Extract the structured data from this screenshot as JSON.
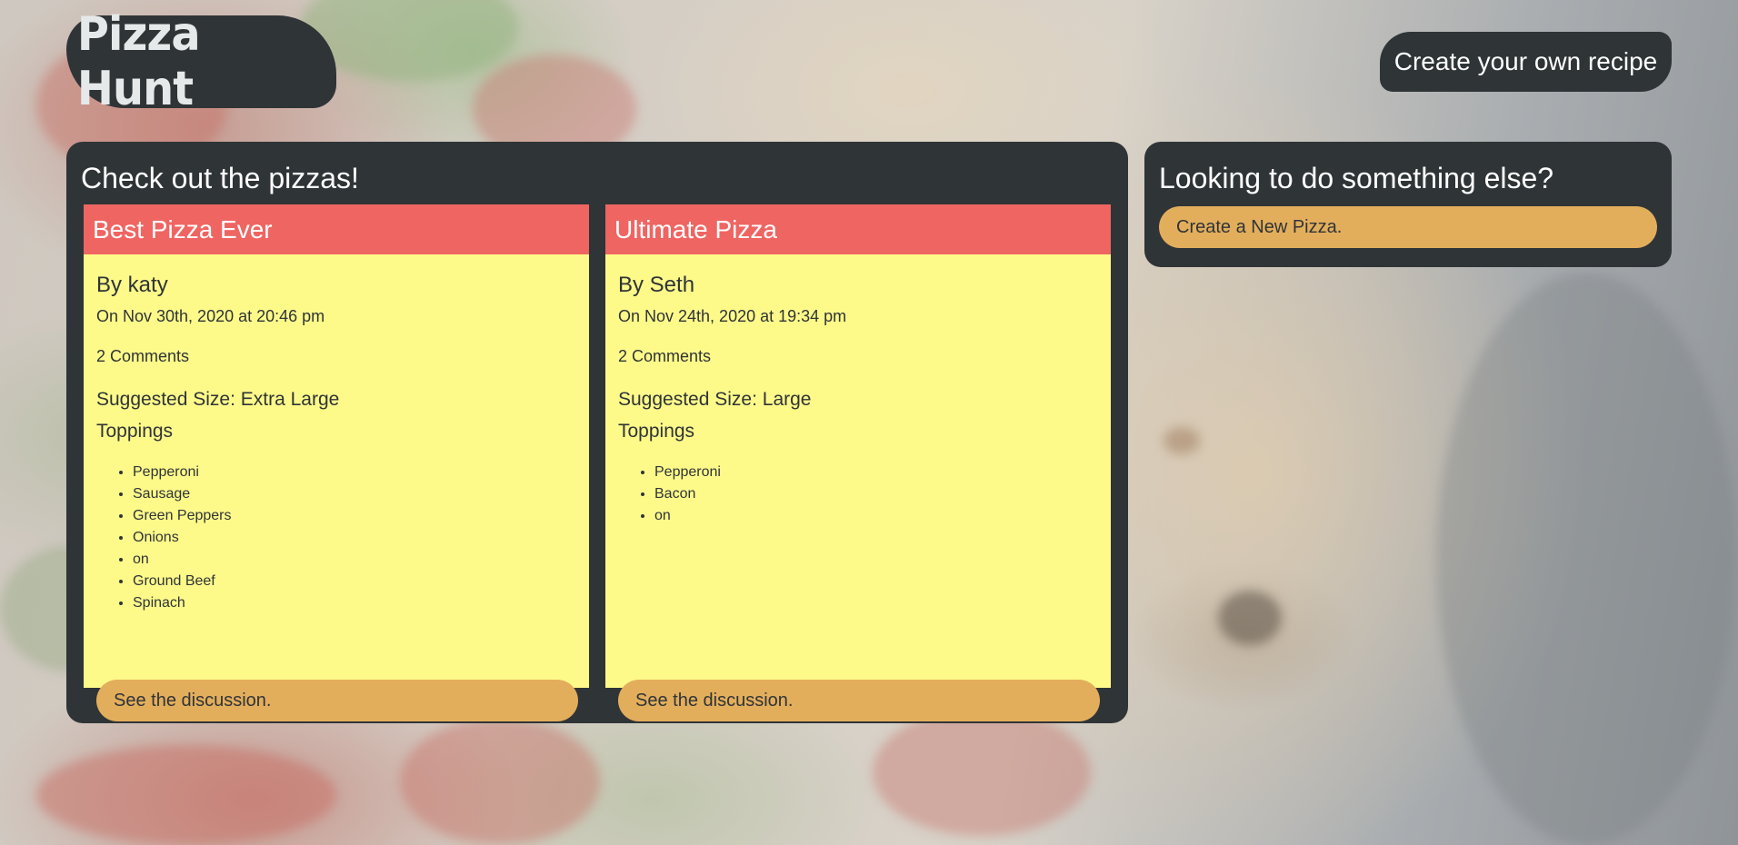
{
  "header": {
    "brand": "Pizza Hunt",
    "create_recipe_label": "Create your own recipe"
  },
  "main": {
    "heading": "Check out the pizzas!",
    "pizzas": [
      {
        "title": "Best Pizza Ever",
        "author": "By katy",
        "date": "On Nov 30th, 2020 at 20:46 pm",
        "comments": "2 Comments",
        "size": "Suggested Size: Extra Large",
        "toppings_label": "Toppings",
        "toppings": [
          "Pepperoni",
          "Sausage",
          "Green Peppers",
          "Onions",
          "on",
          "Ground Beef",
          "Spinach"
        ],
        "discussion_label": "See the discussion."
      },
      {
        "title": "Ultimate Pizza",
        "author": "By Seth",
        "date": "On Nov 24th, 2020 at 19:34 pm",
        "comments": "2 Comments",
        "size": "Suggested Size: Large",
        "toppings_label": "Toppings",
        "toppings": [
          "Pepperoni",
          "Bacon",
          "on"
        ],
        "discussion_label": "See the discussion."
      }
    ]
  },
  "sidebar": {
    "heading": "Looking to do something else?",
    "new_pizza_label": "Create a New Pizza."
  },
  "colors": {
    "panel": "#2f3437",
    "card_header": "#ef6562",
    "card_body": "#fefa8a",
    "button": "#e3ae5c"
  }
}
